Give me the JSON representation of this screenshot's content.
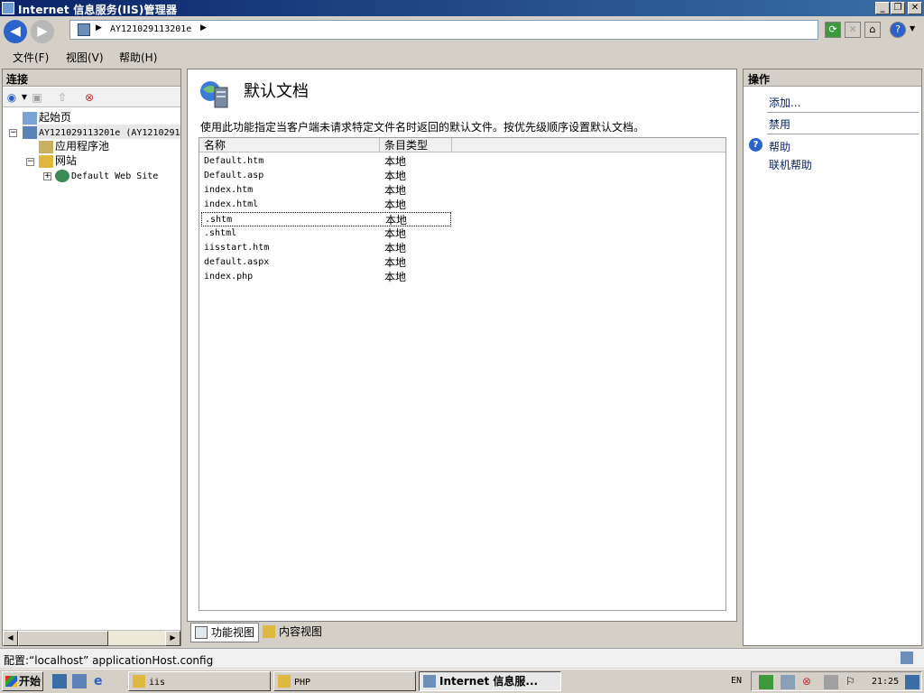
{
  "window": {
    "title": "Internet 信息服务(IIS)管理器",
    "controls": {
      "minimize": "_",
      "restore": "❐",
      "close": "✕"
    }
  },
  "navigation": {
    "back": "◀",
    "forward": "▶",
    "breadcrumb": "AY121029113201e",
    "crumb_arrow": "▶"
  },
  "menu": {
    "file": "文件(F)",
    "view": "视图(V)",
    "help": "帮助(H)"
  },
  "connections": {
    "header": "连接",
    "tree": {
      "start_page": "起始页",
      "server": "AY121029113201e (AY1210291",
      "app_pools": "应用程序池",
      "sites": "网站",
      "default_site": "Default Web Site"
    }
  },
  "feature": {
    "title": "默认文档",
    "description": "使用此功能指定当客户端未请求特定文件名时返回的默认文件。按优先级顺序设置默认文档。",
    "columns": {
      "name": "名称",
      "entry_type": "条目类型"
    },
    "rows": [
      {
        "name": "Default.htm",
        "type": "本地"
      },
      {
        "name": "Default.asp",
        "type": "本地"
      },
      {
        "name": "index.htm",
        "type": "本地"
      },
      {
        "name": "index.html",
        "type": "本地"
      },
      {
        "name": ".shtm",
        "type": "本地"
      },
      {
        "name": ".shtml",
        "type": "本地"
      },
      {
        "name": "iisstart.htm",
        "type": "本地"
      },
      {
        "name": "default.aspx",
        "type": "本地"
      },
      {
        "name": "index.php",
        "type": "本地"
      }
    ],
    "selected_row": ".shtm"
  },
  "view_tabs": {
    "features_view": "功能视图",
    "content_view": "内容视图"
  },
  "actions": {
    "header": "操作",
    "add": "添加...",
    "disable": "禁用",
    "help": "帮助",
    "online_help": "联机帮助"
  },
  "status": {
    "text": "配置:“localhost” applicationHost.config"
  },
  "taskbar": {
    "start": "开始",
    "tasks": {
      "iis": "iis",
      "php": "PHP",
      "iis_manager": "Internet 信息服..."
    },
    "language": "EN",
    "clock": "21:25"
  },
  "colors": {
    "titlebar_start": "#0a246a",
    "titlebar_end": "#3a6ea5",
    "link": "#0a246a",
    "chrome": "#d4d0c8"
  }
}
